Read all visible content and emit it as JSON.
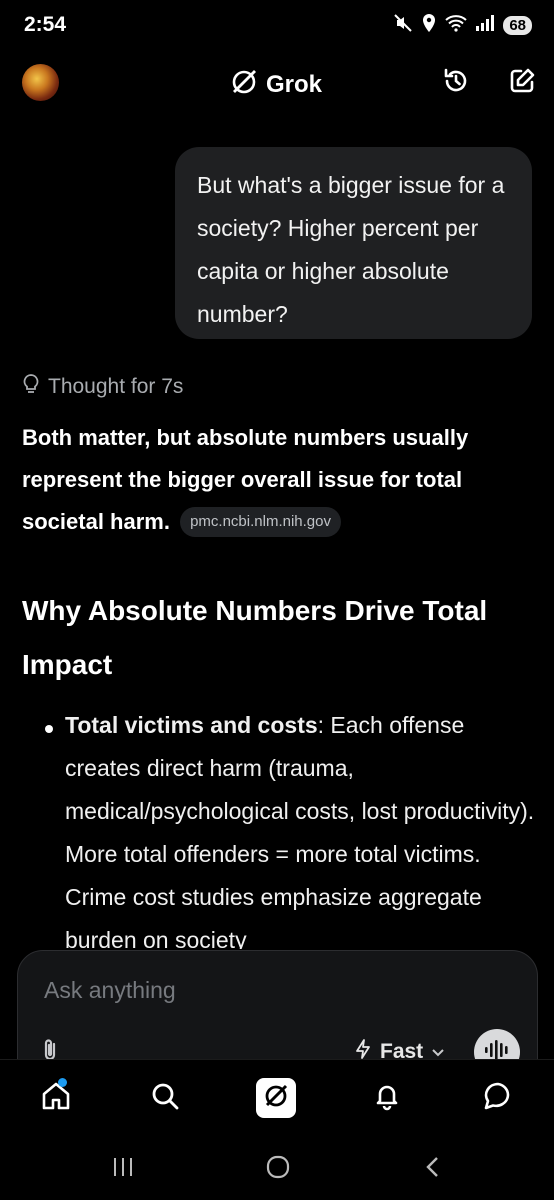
{
  "status_bar": {
    "time": "2:54",
    "battery": "68"
  },
  "header": {
    "title": "Grok"
  },
  "conversation": {
    "user_message": "But what's a bigger issue for a society? Higher percent per capita or higher absolute number?",
    "thought_label": "Thought for 7s",
    "answer_summary": "Both matter, but absolute numbers usually represent the bigger overall issue for total societal harm.",
    "source_chip": "pmc.ncbi.nlm.nih.gov",
    "section_heading": "Why Absolute Numbers Drive Total Impact",
    "bullets": [
      {
        "title": "Total victims and costs",
        "text": ": Each offense creates direct harm (trauma, medical/psychological costs, lost productivity). More total offenders = more total victims. Crime cost studies emphasize aggregate burden on society"
      }
    ]
  },
  "composer": {
    "placeholder": "Ask anything",
    "mode_label": "Fast"
  },
  "colors": {
    "background": "#000000",
    "bubble": "#1f2022",
    "composer": "#141517",
    "notification_dot": "#1d9bf0"
  }
}
